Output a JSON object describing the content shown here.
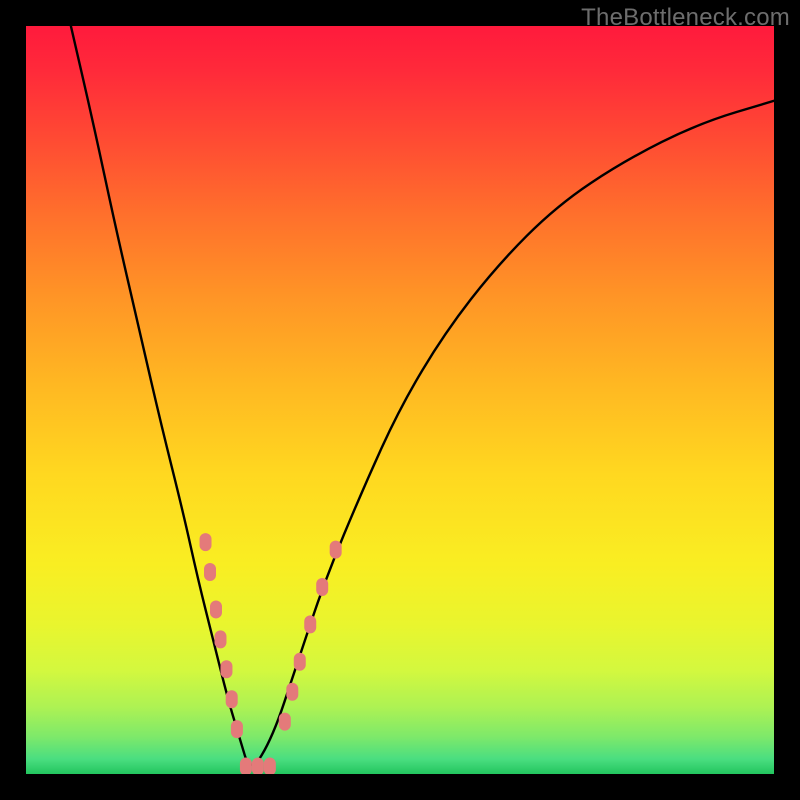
{
  "watermark": "TheBottleneck.com",
  "chart_data": {
    "type": "line",
    "title": "",
    "xlabel": "",
    "ylabel": "",
    "xlim": [
      0,
      100
    ],
    "ylim": [
      0,
      100
    ],
    "series": [
      {
        "name": "bottleneck-curve",
        "x": [
          6,
          9,
          12,
          15,
          18,
          21,
          23,
          25,
          27,
          28.5,
          30,
          33,
          36,
          40,
          45,
          50,
          56,
          63,
          71,
          80,
          90,
          100
        ],
        "y": [
          100,
          87,
          73,
          60,
          47,
          35,
          26,
          18,
          10,
          5,
          0,
          5,
          14,
          26,
          38,
          49,
          59,
          68,
          76,
          82,
          87,
          90
        ]
      }
    ],
    "markers": {
      "name": "highlighted-points",
      "color": "#e47a7a",
      "points": [
        {
          "x": 24.0,
          "y": 31
        },
        {
          "x": 24.6,
          "y": 27
        },
        {
          "x": 25.4,
          "y": 22
        },
        {
          "x": 26.0,
          "y": 18
        },
        {
          "x": 26.8,
          "y": 14
        },
        {
          "x": 27.5,
          "y": 10
        },
        {
          "x": 28.2,
          "y": 6
        },
        {
          "x": 29.4,
          "y": 1
        },
        {
          "x": 31.0,
          "y": 1
        },
        {
          "x": 32.6,
          "y": 1
        },
        {
          "x": 34.6,
          "y": 7
        },
        {
          "x": 35.6,
          "y": 11
        },
        {
          "x": 36.6,
          "y": 15
        },
        {
          "x": 38.0,
          "y": 20
        },
        {
          "x": 39.6,
          "y": 25
        },
        {
          "x": 41.4,
          "y": 30
        }
      ]
    },
    "background_gradient": {
      "top": "#ff1a3c",
      "bottom": "#22c55e"
    }
  }
}
